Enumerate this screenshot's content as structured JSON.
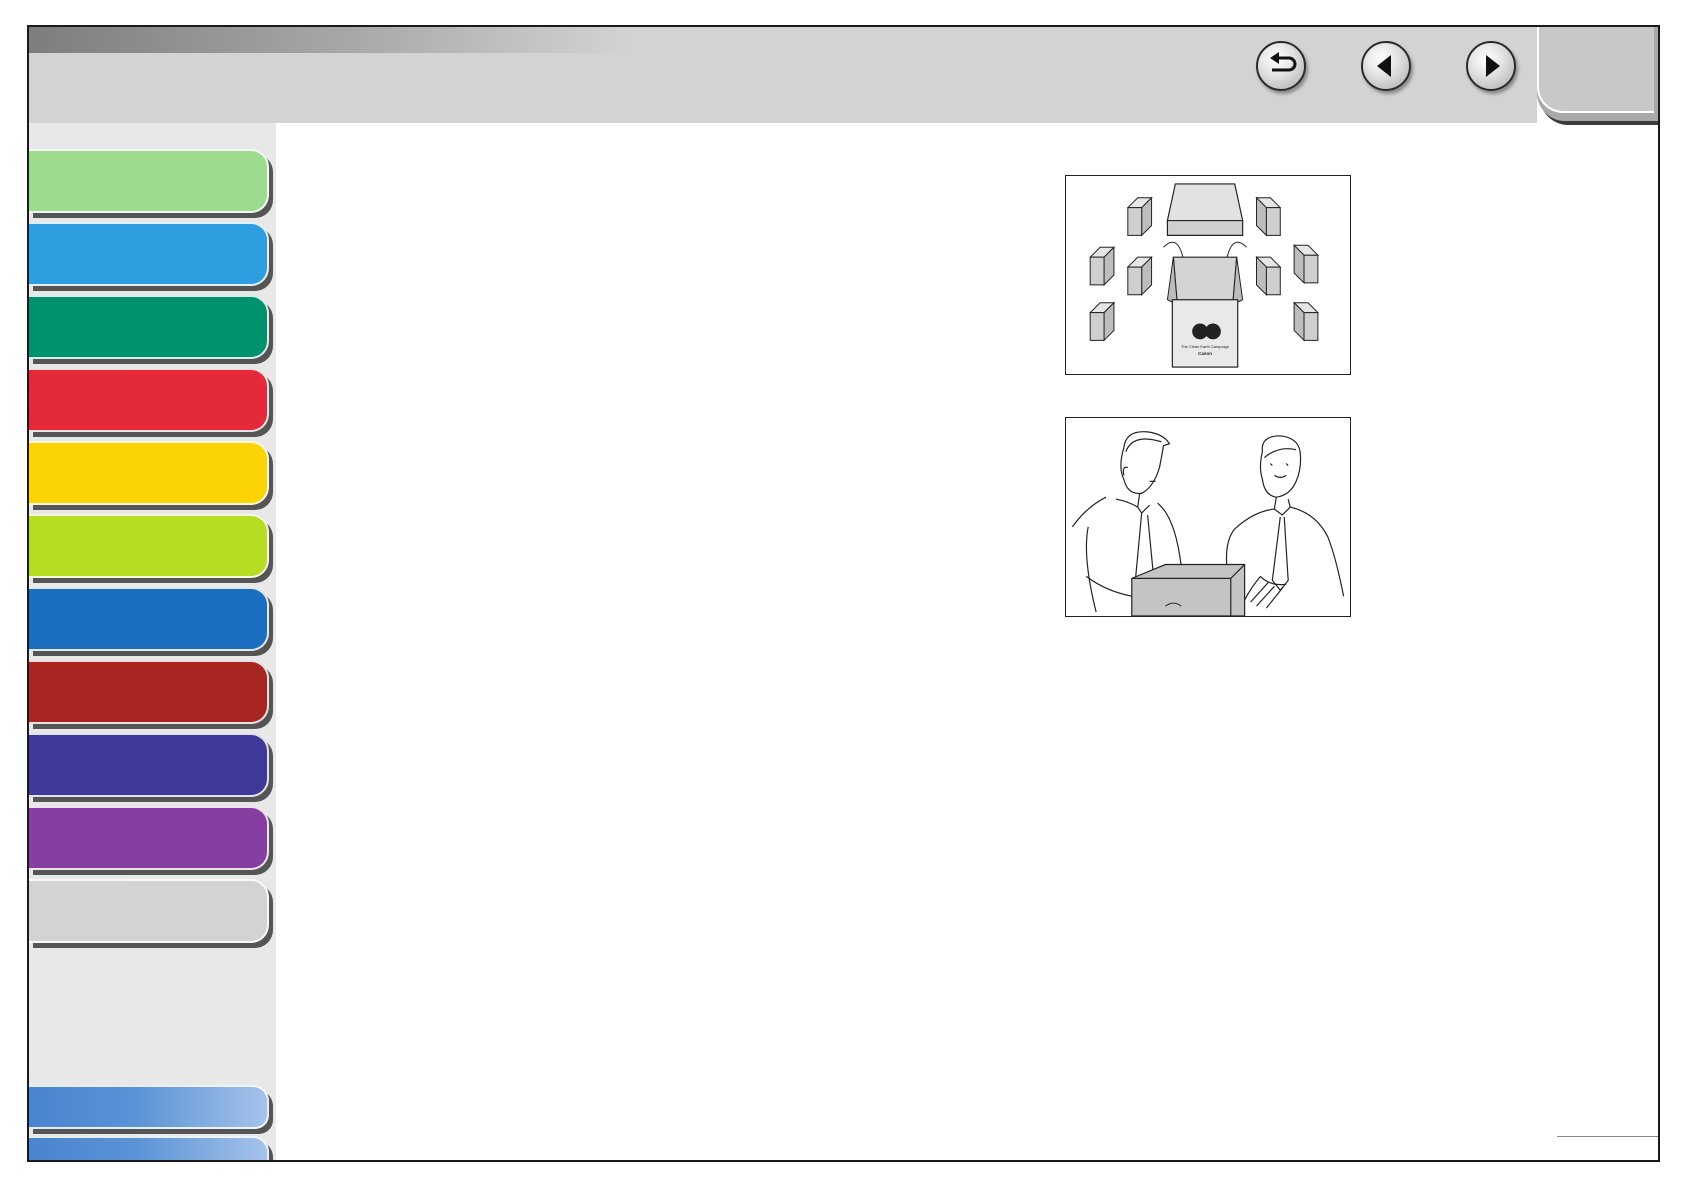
{
  "header": {
    "nav_buttons": [
      {
        "name": "back-button",
        "icon": "return-arrow-icon"
      },
      {
        "name": "previous-page-button",
        "icon": "triangle-left-icon"
      },
      {
        "name": "next-page-button",
        "icon": "triangle-right-icon"
      }
    ],
    "corner_tab": {
      "label": ""
    }
  },
  "sidebar": {
    "chapter_tabs": [
      {
        "label": "",
        "color": "#9ddc8f"
      },
      {
        "label": "",
        "color": "#2d9fe0"
      },
      {
        "label": "",
        "color": "#00916e"
      },
      {
        "label": "",
        "color": "#e4293b"
      },
      {
        "label": "",
        "color": "#fcd304"
      },
      {
        "label": "",
        "color": "#b6dd22"
      },
      {
        "label": "",
        "color": "#1b6ebf"
      },
      {
        "label": "",
        "color": "#a72621"
      },
      {
        "label": "",
        "color": "#3f3a9a"
      },
      {
        "label": "",
        "color": "#873ea3"
      },
      {
        "label": "",
        "color": "#d3d3d3"
      }
    ],
    "bottom_tabs": [
      {
        "label": "",
        "color": "#4a84cf"
      },
      {
        "label": "",
        "color": "#4a84cf"
      }
    ]
  },
  "illustrations": [
    {
      "name": "recycling-illustration",
      "logo_text": [
        "The Clean Earth Campaign",
        "Canon"
      ]
    },
    {
      "name": "two-men-box-illustration"
    }
  ],
  "colors": {
    "topbar": "#d3d3d3",
    "sidebar": "#e8e8e8",
    "frame": "#1a1a1a"
  }
}
